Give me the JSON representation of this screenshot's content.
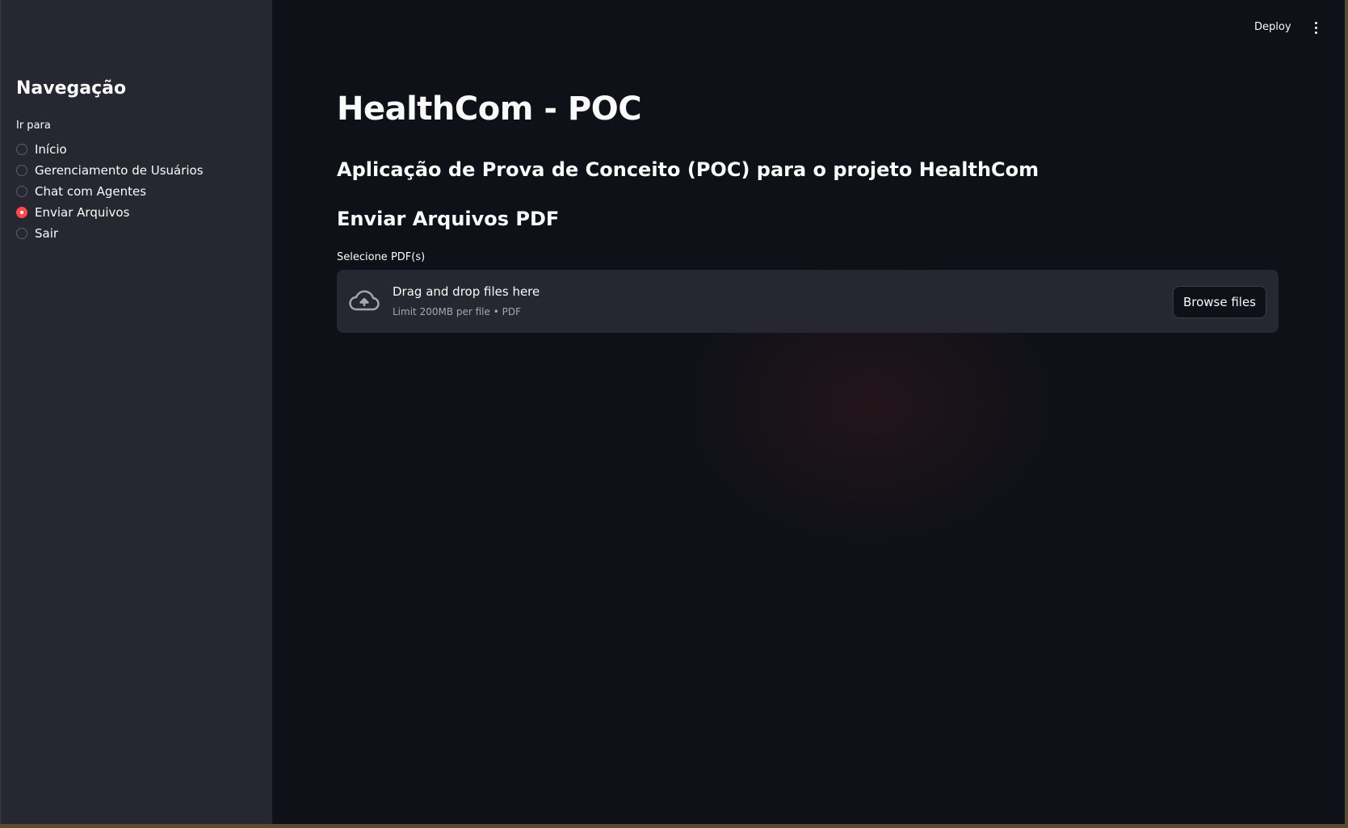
{
  "sidebar": {
    "title": "Navegação",
    "radio_label": "Ir para",
    "options": [
      {
        "label": "Início",
        "selected": false
      },
      {
        "label": "Gerenciamento de Usuários",
        "selected": false
      },
      {
        "label": "Chat com Agentes",
        "selected": false
      },
      {
        "label": "Enviar Arquivos",
        "selected": true
      },
      {
        "label": "Sair",
        "selected": false
      }
    ]
  },
  "header": {
    "deploy_label": "Deploy",
    "menu_icon": "vertical-ellipsis-icon"
  },
  "main": {
    "title": "HealthCom - POC",
    "subtitle": "Aplicação de Prova de Conceito (POC) para o projeto HealthCom",
    "section_title": "Enviar Arquivos PDF",
    "uploader": {
      "label": "Selecione PDF(s)",
      "dropzone_text": "Drag and drop files here",
      "limit_text": "Limit 200MB per file • PDF",
      "browse_label": "Browse files",
      "icon": "cloud-upload-icon"
    }
  },
  "colors": {
    "accent": "#ff4b4b",
    "sidebar_bg": "#262730",
    "main_bg": "#0e1117",
    "text": "#fafafa"
  }
}
